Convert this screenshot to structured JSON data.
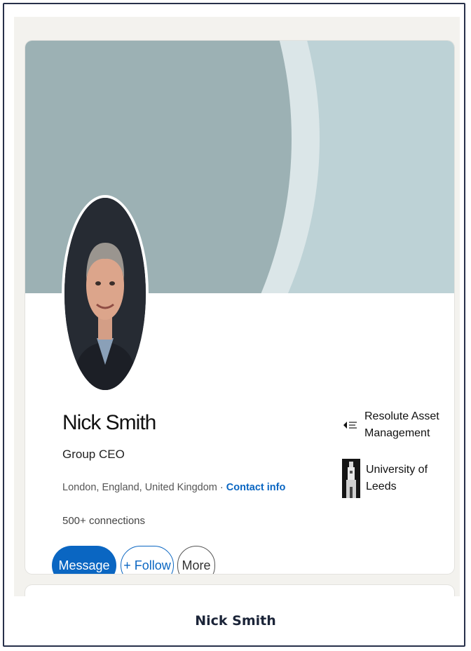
{
  "profile": {
    "name": "Nick Smith",
    "headline": "Group CEO",
    "location": "London, England, United Kingdom",
    "separator": " · ",
    "contact_info_label": "Contact info",
    "connections": "500+ connections"
  },
  "actions": {
    "message_label": "Message",
    "follow_label": "+ Follow",
    "more_label": "More"
  },
  "organizations": [
    {
      "name": "Resolute Asset Management",
      "logo_icon": "resolute-logo-icon"
    },
    {
      "name": "University of Leeds",
      "logo_icon": "university-tower-icon"
    }
  ],
  "caption": "Nick Smith",
  "colors": {
    "accent": "#0a66c2",
    "banner": "#9cb1b4",
    "banner_light": "#bdd2d6",
    "page_background": "#f3f2ee"
  }
}
